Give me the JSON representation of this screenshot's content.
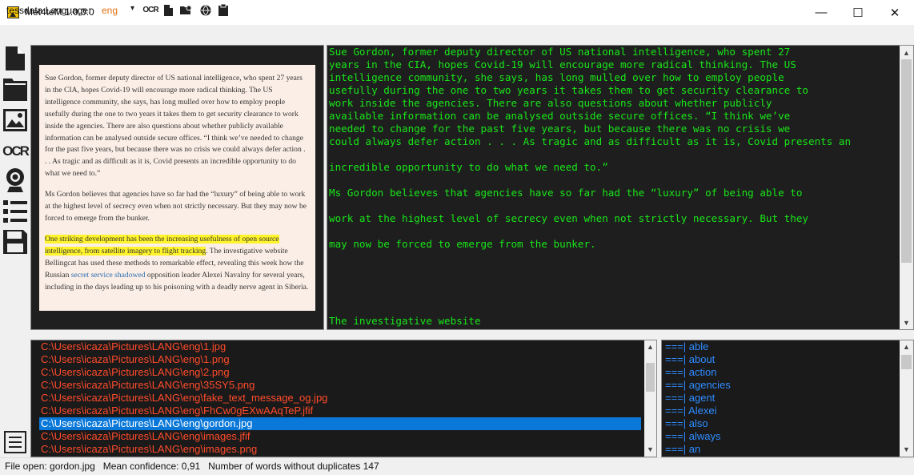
{
  "window": {
    "title": "Met4teM 1.0.0.0",
    "minimize": "—",
    "maximize": "☐",
    "close": "✕"
  },
  "toolbar": {
    "tessdata_label": "tessdata Language:",
    "language": "eng",
    "dropdown_arrow": "▾",
    "ocr_label": "OCR",
    "icons": [
      "ocr-icon",
      "new-file-icon",
      "camera-folder-icon",
      "globe-icon",
      "clipboard-icon"
    ]
  },
  "sidebar": {
    "ocr_label": "OCR",
    "icons": [
      "new-file-icon",
      "folder-icon",
      "image-icon",
      "ocr-icon",
      "webcam-icon",
      "list-icon",
      "save-icon",
      "menu-icon"
    ]
  },
  "document_image": {
    "para1": "Sue Gordon, former deputy director of US national intelligence, who spent 27 years in the CIA, hopes Covid-19 will encourage more radical thinking. The US intelligence community, she says, has long mulled over how to employ people usefully during the one to two years it takes them to get security clearance to work inside the agencies. There are also questions about whether publicly available information can be analysed outside secure offices. “I think we’ve needed to change for the past five years, but because there was no crisis we could always defer action . . . As tragic and as difficult as it is, Covid presents an incredible opportunity to do what we need to.”",
    "para2": "Ms Gordon believes that agencies have so far had the “luxury” of being able to work at the highest level of secrecy even when not strictly necessary. But they may now be forced to emerge from the bunker.",
    "para3_highlight": "One striking development has been the increasing usefulness of open source intelligence, from satellite imagery to flight tracking",
    "para3_a": ". The investigative website Bellingcat has used these methods to remarkable effect, revealing this week how the Russian ",
    "para3_link": "secret service shadowed",
    "para3_b": " opposition leader Alexei Navalny for several years, including in the days leading up to his poisoning with a deadly nerve agent in Siberia."
  },
  "ocr_output": {
    "lines": [
      "Sue Gordon, former deputy director of US national intelligence, who spent 27",
      "years in the CIA, hopes Covid-19 will encourage more radical thinking. The US",
      "intelligence community, she says, has long mulled over how to employ people",
      "usefully during the one to two years it takes them to get security clearance to",
      "work inside the agencies. There are also questions about whether publicly",
      "available information can be analysed outside secure offices. “I think we’ve",
      "needed to change for the past five years, but because there was no crisis we",
      "could always defer action . . . As tragic and as difficult as it is, Covid presents an",
      "",
      "incredible opportunity to do what we need to.”",
      "",
      "Ms Gordon believes that agencies have so far had the “luxury” of being able to",
      "",
      "work at the highest level of secrecy even when not strictly necessary. But they",
      "",
      "may now be forced to emerge from the bunker.",
      "",
      "",
      "",
      "",
      "",
      "The investigative website"
    ]
  },
  "file_list": {
    "selected_index": 6,
    "items": [
      "C:\\Users\\icaza\\Pictures\\LANG\\eng\\1.jpg",
      "C:\\Users\\icaza\\Pictures\\LANG\\eng\\1.png",
      "C:\\Users\\icaza\\Pictures\\LANG\\eng\\2.png",
      "C:\\Users\\icaza\\Pictures\\LANG\\eng\\35SY5.png",
      "C:\\Users\\icaza\\Pictures\\LANG\\eng\\fake_text_message_og.jpg",
      "C:\\Users\\icaza\\Pictures\\LANG\\eng\\FhCw0gEXwAAqTeP.jfif",
      "C:\\Users\\icaza\\Pictures\\LANG\\eng\\gordon.jpg",
      "C:\\Users\\icaza\\Pictures\\LANG\\eng\\images.jfif",
      "C:\\Users\\icaza\\Pictures\\LANG\\eng\\images.png"
    ]
  },
  "word_list": {
    "prefix": "===|",
    "items": [
      "able",
      "about",
      "action",
      "agencies",
      "agent",
      "Alexei",
      "also",
      "always",
      "an"
    ]
  },
  "status": {
    "text": "File open: gordon.jpg   Mean confidence: 0,91   Number of words without duplicates 147"
  },
  "colors": {
    "ocr_text": "#19e619",
    "file_text": "#ff4b2b",
    "word_text": "#2f8cff",
    "selection": "#0a78d8",
    "highlight": "#fff32b"
  }
}
